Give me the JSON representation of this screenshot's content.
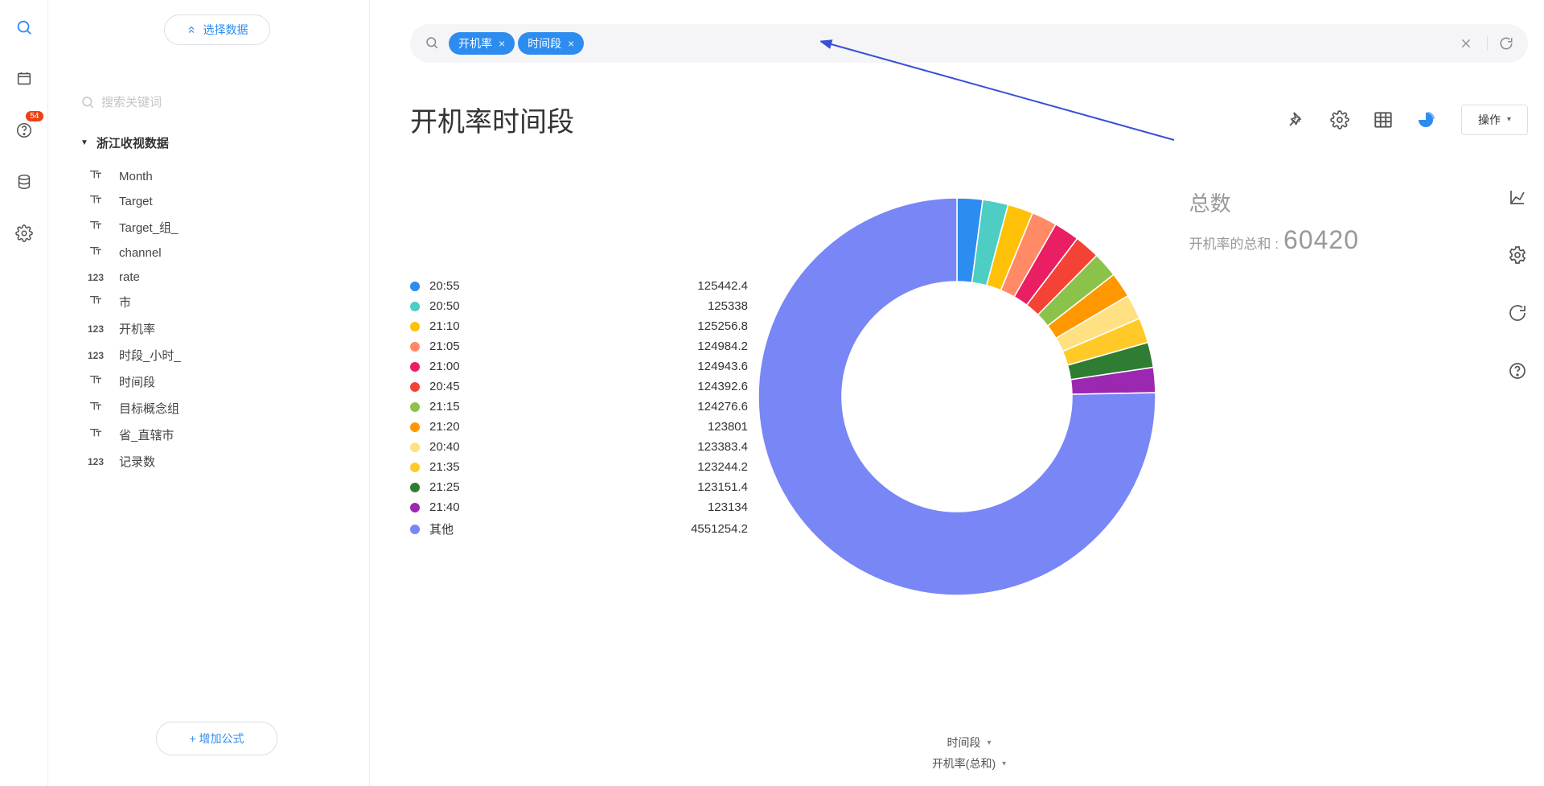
{
  "rail": {
    "badge": "54"
  },
  "sidebar": {
    "select_data_btn": "选择数据",
    "search_placeholder": "搜索关键词",
    "tree_title": "浙江收视数据",
    "fields": [
      {
        "type": "T",
        "name": "Month"
      },
      {
        "type": "T",
        "name": "Target"
      },
      {
        "type": "T",
        "name": "Target_组_"
      },
      {
        "type": "T",
        "name": "channel"
      },
      {
        "type": "123",
        "name": "rate"
      },
      {
        "type": "T",
        "name": "市"
      },
      {
        "type": "123",
        "name": "开机率"
      },
      {
        "type": "123",
        "name": "时段_小时_"
      },
      {
        "type": "T",
        "name": "时间段"
      },
      {
        "type": "T",
        "name": "目标概念组"
      },
      {
        "type": "T",
        "name": "省_直辖市"
      },
      {
        "type": "123",
        "name": "记录数"
      }
    ],
    "add_formula_btn": "+  增加公式"
  },
  "search": {
    "chips": [
      {
        "label": "开机率"
      },
      {
        "label": "时间段"
      }
    ]
  },
  "title": "开机率时间段",
  "ops_btn": "操作",
  "totals": {
    "label": "总数",
    "sum_prefix": "开机率的总和 :",
    "sum_value": "60420"
  },
  "bottom": {
    "dim": "时间段",
    "measure": "开机率(总和)"
  },
  "legend_other": "其他",
  "chart_data": {
    "type": "pie",
    "title": "开机率时间段",
    "series_name": "开机率(总和)",
    "categories": [
      "20:55",
      "20:50",
      "21:10",
      "21:05",
      "21:00",
      "20:45",
      "21:15",
      "21:20",
      "20:40",
      "21:35",
      "21:25",
      "21:40",
      "其他"
    ],
    "values": [
      125442.4,
      125338,
      125256.8,
      124984.2,
      124943.6,
      124392.6,
      124276.6,
      123801,
      123383.4,
      123244.2,
      123151.4,
      123134,
      4551254.2
    ],
    "colors": [
      "#2d8cf0",
      "#4ecdc4",
      "#ffc107",
      "#ff8a65",
      "#e91e63",
      "#f44336",
      "#8bc34a",
      "#ff9800",
      "#ffe082",
      "#ffca28",
      "#2e7d32",
      "#9c27b0",
      "#7986f5"
    ]
  }
}
